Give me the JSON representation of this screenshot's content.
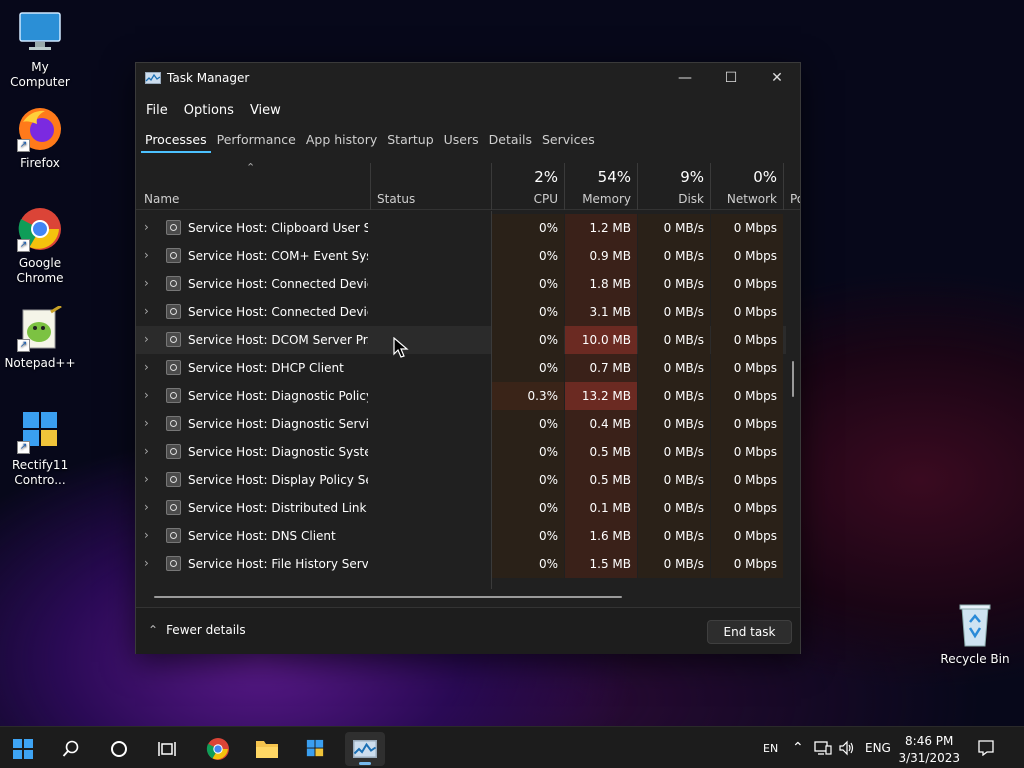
{
  "desktop": {
    "icons": [
      {
        "label": "My Computer"
      },
      {
        "label": "Firefox"
      },
      {
        "label": "Google Chrome"
      },
      {
        "label": "Notepad++"
      },
      {
        "label": "Rectify11 Contro..."
      },
      {
        "label": "Recycle Bin"
      }
    ]
  },
  "window": {
    "title": "Task Manager",
    "menu": [
      "File",
      "Options",
      "View"
    ],
    "tabs": [
      "Processes",
      "Performance",
      "App history",
      "Startup",
      "Users",
      "Details",
      "Services"
    ],
    "active_tab": "Processes",
    "columns": {
      "name": "Name",
      "status": "Status",
      "cpu": {
        "pct": "2%",
        "label": "CPU"
      },
      "memory": {
        "pct": "54%",
        "label": "Memory"
      },
      "disk": {
        "pct": "9%",
        "label": "Disk"
      },
      "network": {
        "pct": "0%",
        "label": "Network"
      },
      "power": "Po"
    },
    "processes": [
      {
        "name": "Service Host: Clipboard User S...",
        "cpu": "0%",
        "memory": "1.2 MB",
        "disk": "0 MB/s",
        "network": "0 Mbps"
      },
      {
        "name": "Service Host: COM+ Event Syst...",
        "cpu": "0%",
        "memory": "0.9 MB",
        "disk": "0 MB/s",
        "network": "0 Mbps"
      },
      {
        "name": "Service Host: Connected Devic...",
        "cpu": "0%",
        "memory": "1.8 MB",
        "disk": "0 MB/s",
        "network": "0 Mbps"
      },
      {
        "name": "Service Host: Connected Devic...",
        "cpu": "0%",
        "memory": "3.1 MB",
        "disk": "0 MB/s",
        "network": "0 Mbps"
      },
      {
        "name": "Service Host: DCOM Server Pr...",
        "cpu": "0%",
        "memory": "10.0 MB",
        "disk": "0 MB/s",
        "network": "0 Mbps"
      },
      {
        "name": "Service Host: DHCP Client",
        "cpu": "0%",
        "memory": "0.7 MB",
        "disk": "0 MB/s",
        "network": "0 Mbps"
      },
      {
        "name": "Service Host: Diagnostic Policy ...",
        "cpu": "0.3%",
        "memory": "13.2 MB",
        "disk": "0 MB/s",
        "network": "0 Mbps"
      },
      {
        "name": "Service Host: Diagnostic Servic...",
        "cpu": "0%",
        "memory": "0.4 MB",
        "disk": "0 MB/s",
        "network": "0 Mbps"
      },
      {
        "name": "Service Host: Diagnostic Syste...",
        "cpu": "0%",
        "memory": "0.5 MB",
        "disk": "0 MB/s",
        "network": "0 Mbps"
      },
      {
        "name": "Service Host: Display Policy Ser...",
        "cpu": "0%",
        "memory": "0.5 MB",
        "disk": "0 MB/s",
        "network": "0 Mbps"
      },
      {
        "name": "Service Host: Distributed Link T...",
        "cpu": "0%",
        "memory": "0.1 MB",
        "disk": "0 MB/s",
        "network": "0 Mbps"
      },
      {
        "name": "Service Host: DNS Client",
        "cpu": "0%",
        "memory": "1.6 MB",
        "disk": "0 MB/s",
        "network": "0 Mbps"
      },
      {
        "name": "Service Host: File History Service",
        "cpu": "0%",
        "memory": "1.5 MB",
        "disk": "0 MB/s",
        "network": "0 Mbps"
      }
    ],
    "footer": {
      "fewer_details": "Fewer details",
      "end_task": "End task"
    }
  },
  "taskbar": {
    "tray_lang": "EN",
    "input_lang": "ENG",
    "time": "8:46 PM",
    "date": "3/31/2023"
  }
}
